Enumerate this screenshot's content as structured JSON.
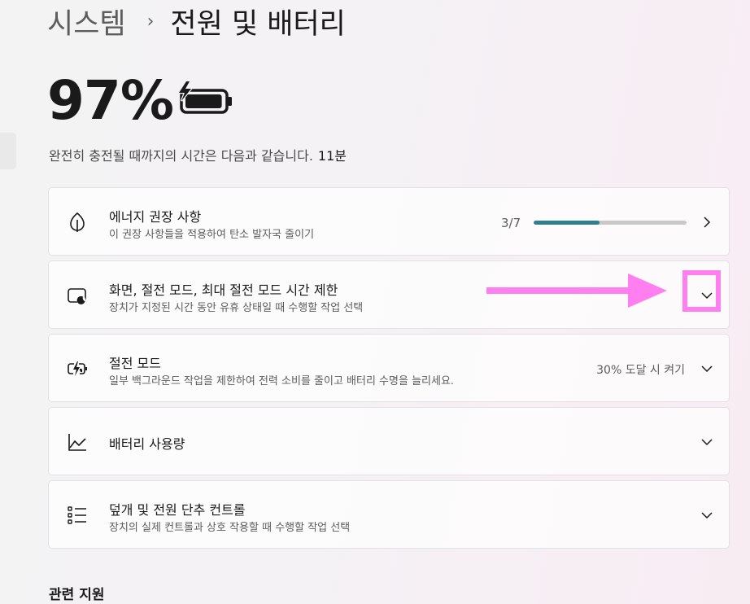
{
  "breadcrumb": {
    "parent": "시스템",
    "separator": "›",
    "current": "전원 및 배터리"
  },
  "battery": {
    "percent": "97%",
    "icon": "battery-charging-icon",
    "charge_level": 0.97,
    "charge_time_label": "완전히 충전될 때까지의 시간은 다음과 같습니다.",
    "charge_time_value": "11분"
  },
  "cards": {
    "energy": {
      "icon": "leaf-icon",
      "title": "에너지 권장 사항",
      "subtitle": "이 권장 사항들을 적용하여 탄소 발자국 줄이기",
      "progress_text": "3/7",
      "progress_fraction": 0.4286,
      "chevron": "chevron-right-icon"
    },
    "screen_sleep": {
      "icon": "screen-sleep-icon",
      "title": "화면, 절전 모드, 최대 절전 모드 시간 제한",
      "subtitle": "장치가 지정된 시간 동안 유휴 상태일 때 수행할 작업 선택",
      "chevron": "chevron-down-icon"
    },
    "battery_saver": {
      "icon": "battery-saver-icon",
      "title": "절전 모드",
      "subtitle": "일부 백그라운드 작업을 제한하여 전력 소비를 줄이고 배터리 수명을 늘리세요.",
      "value": "30% 도달 시 켜기",
      "chevron": "chevron-down-icon"
    },
    "battery_usage": {
      "icon": "line-chart-icon",
      "title": "배터리 사용량",
      "chevron": "chevron-down-icon"
    },
    "lid_power": {
      "icon": "list-icon",
      "title": "덮개 및 전원 단추 컨트롤",
      "subtitle": "장치의 실제 컨트롤과 상호 작용할 때 수행할 작업 선택",
      "chevron": "chevron-down-icon"
    }
  },
  "annotation": {
    "color": "#ff7ef0"
  },
  "related_support": "관련 지원"
}
